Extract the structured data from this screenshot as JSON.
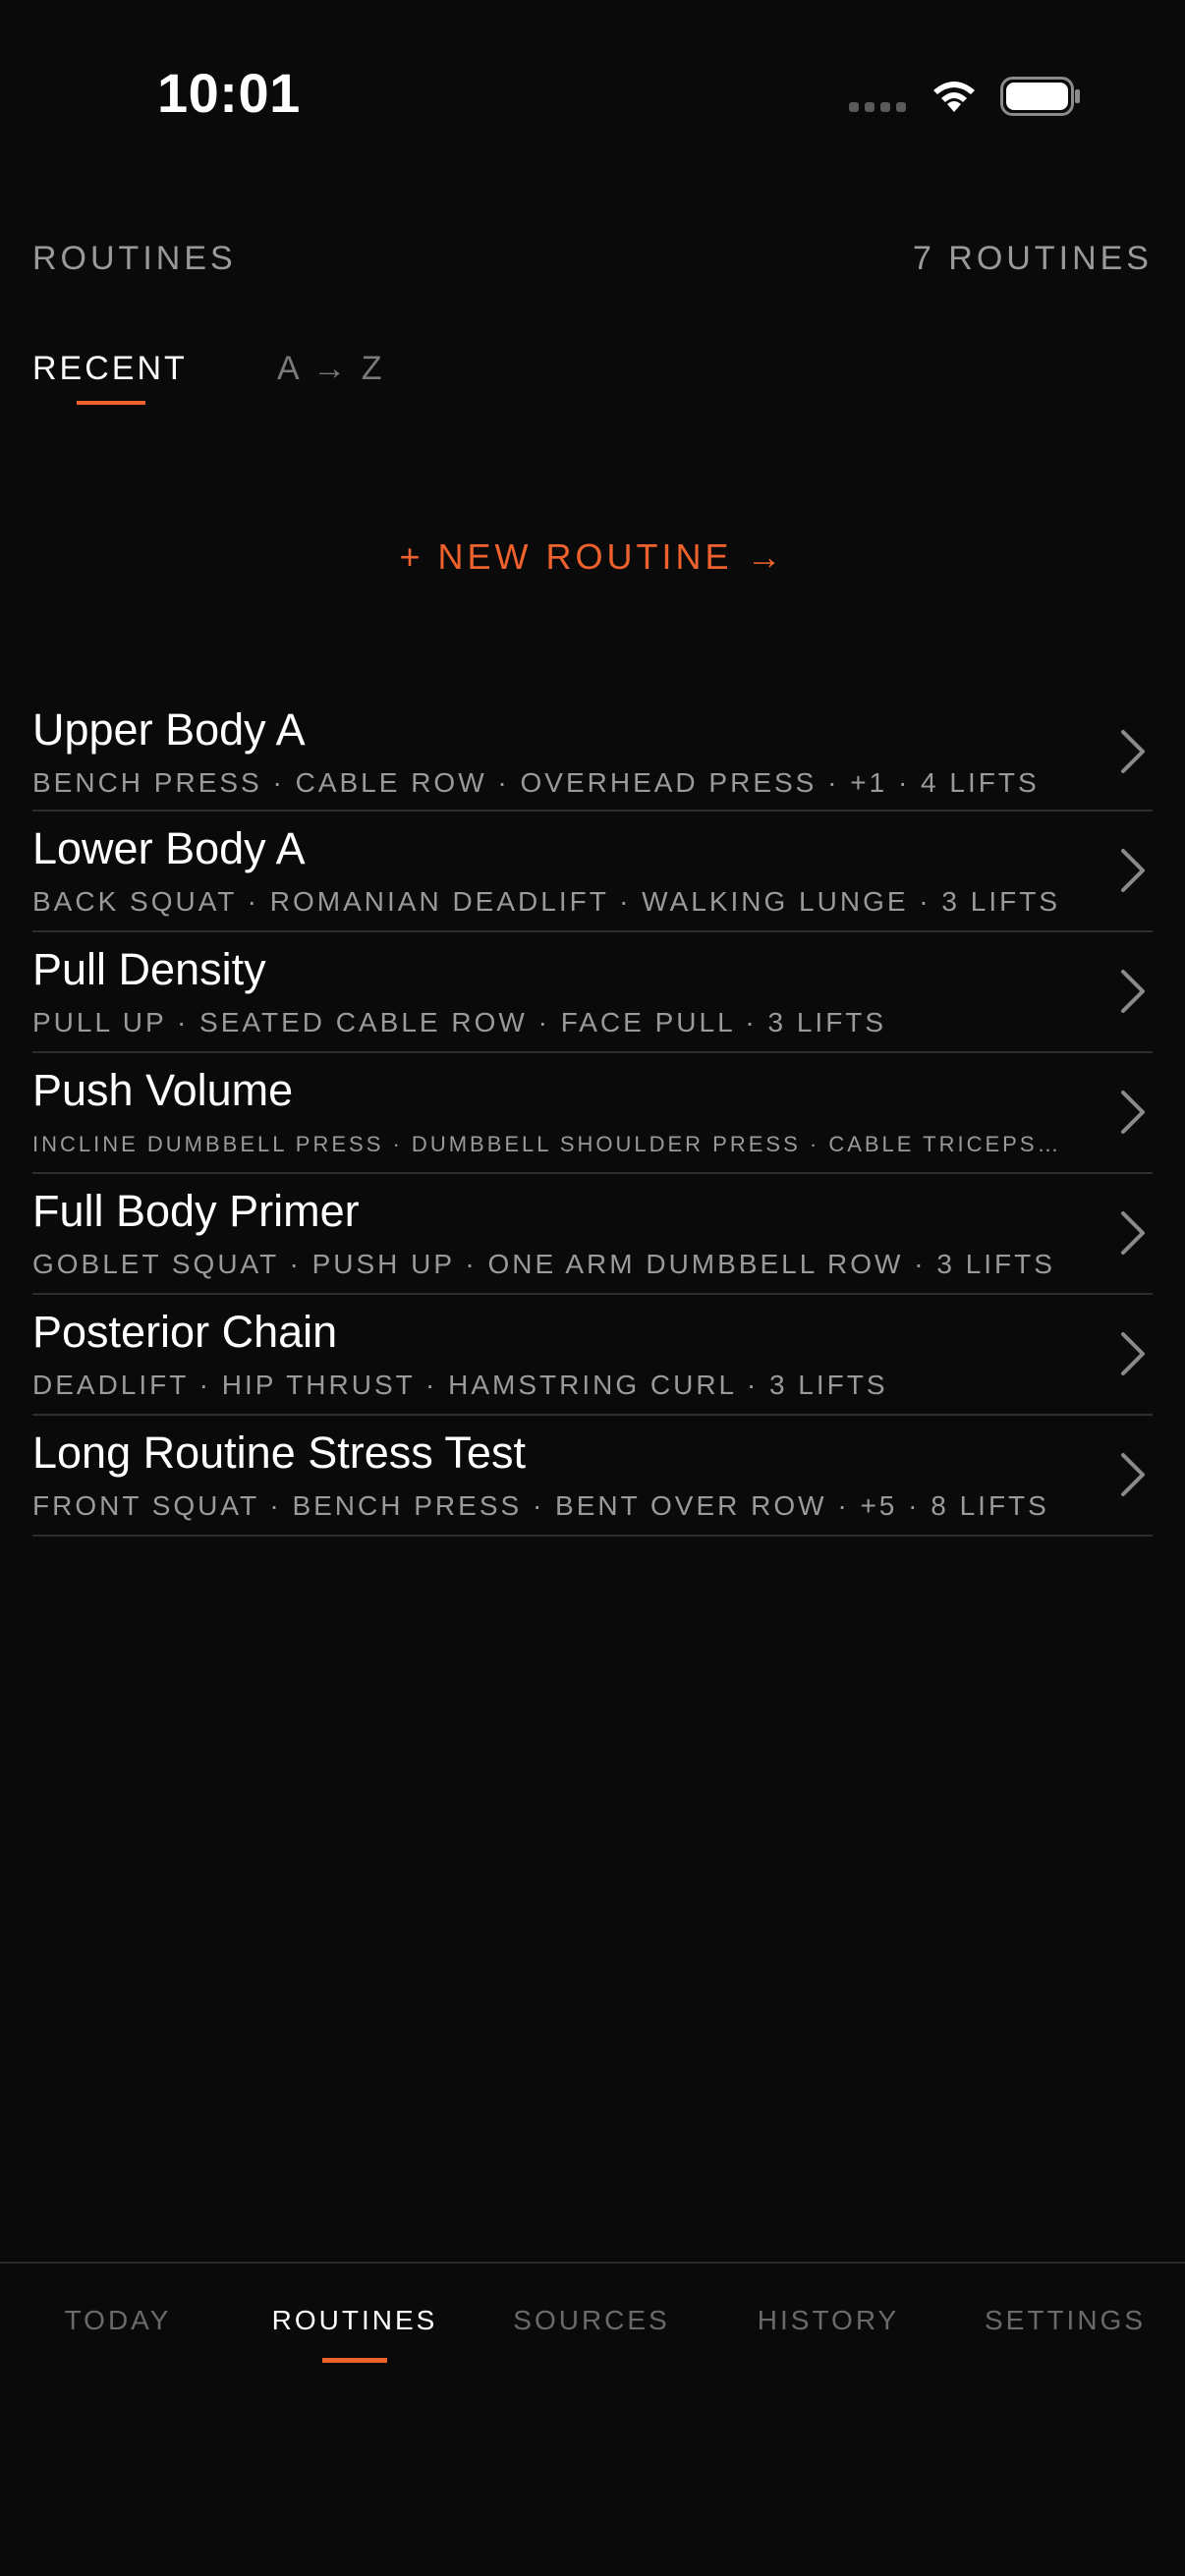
{
  "status_bar": {
    "time": "10:01"
  },
  "header": {
    "title": "ROUTINES",
    "count": "7 ROUTINES"
  },
  "sort_tabs": {
    "recent": "RECENT",
    "az": "A → Z",
    "active": "recent"
  },
  "new_routine": {
    "label": "+ NEW ROUTINE →"
  },
  "routines": [
    {
      "name": "Upper Body A",
      "lifts": "BENCH PRESS · CABLE ROW · OVERHEAD PRESS · +1 · 4 LIFTS"
    },
    {
      "name": "Lower Body A",
      "lifts": "BACK SQUAT · ROMANIAN DEADLIFT · WALKING LUNGE · 3 LIFTS"
    },
    {
      "name": "Pull Density",
      "lifts": "PULL UP · SEATED CABLE ROW · FACE PULL · 3 LIFTS"
    },
    {
      "name": "Push Volume",
      "lifts": "INCLINE DUMBBELL PRESS · DUMBBELL SHOULDER PRESS · CABLE TRICEPS…"
    },
    {
      "name": "Full Body Primer",
      "lifts": "GOBLET SQUAT · PUSH UP · ONE ARM DUMBBELL ROW · 3 LIFTS"
    },
    {
      "name": "Posterior Chain",
      "lifts": "DEADLIFT · HIP THRUST · HAMSTRING CURL · 3 LIFTS"
    },
    {
      "name": "Long Routine Stress Test",
      "lifts": "FRONT SQUAT · BENCH PRESS · BENT OVER ROW · +5 · 8 LIFTS"
    }
  ],
  "tab_bar": {
    "items": [
      "TODAY",
      "ROUTINES",
      "SOURCES",
      "HISTORY",
      "SETTINGS"
    ],
    "active": "ROUTINES"
  },
  "colors": {
    "background": "#0a0a0a",
    "accent": "#f0622d",
    "muted_text": "#9a9a9a",
    "divider": "#2e2e2e"
  },
  "icons": {
    "row_chevron": "chevron-right-icon",
    "wifi": "wifi-icon",
    "battery": "battery-icon",
    "signal": "signal-icon"
  }
}
